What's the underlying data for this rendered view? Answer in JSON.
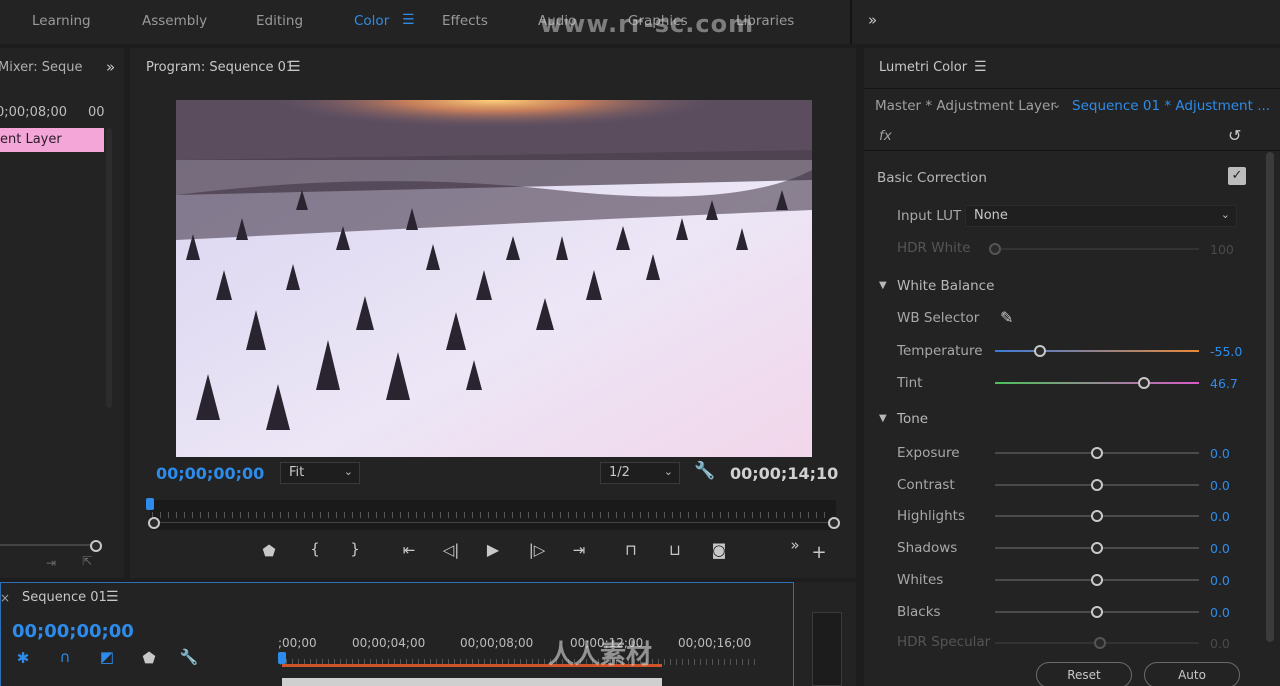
{
  "workspace_tabs": [
    {
      "label": "Learning",
      "active": false
    },
    {
      "label": "Assembly",
      "active": false
    },
    {
      "label": "Editing",
      "active": false
    },
    {
      "label": "Color",
      "active": true
    },
    {
      "label": "Effects",
      "active": false
    },
    {
      "label": "Audio",
      "active": false
    },
    {
      "label": "Graphics",
      "active": false
    },
    {
      "label": "Libraries",
      "active": false
    }
  ],
  "watermark": "www.rr-sc.com",
  "left_panel": {
    "title": "Mixer: Seque",
    "timecode": "0;00;08;00",
    "timecode_end": "00",
    "clip_label": "ent Layer"
  },
  "program": {
    "title": "Program: Sequence 01",
    "current_time": "00;00;00;00",
    "duration": "00;00;14;10",
    "fit_label": "Fit",
    "resolution_label": "1/2"
  },
  "lumetri": {
    "title": "Lumetri Color",
    "master_label": "Master * Adjustment Layer",
    "sequence_label": "Sequence 01 * Adjustment ...",
    "fx_label": "fx",
    "basic_correction": "Basic Correction",
    "input_lut_label": "Input LUT",
    "input_lut_value": "None",
    "hdr_white_label": "HDR White",
    "hdr_white_value": "100",
    "white_balance": "White Balance",
    "wb_selector": "WB Selector",
    "sliders": [
      {
        "label": "Temperature",
        "value": "-55.0",
        "level": 0.22
      },
      {
        "label": "Tint",
        "value": "46.7",
        "level": 0.73
      }
    ],
    "tone": "Tone",
    "tone_sliders": [
      {
        "label": "Exposure",
        "value": "0.0",
        "level": 0.5
      },
      {
        "label": "Contrast",
        "value": "0.0",
        "level": 0.5
      },
      {
        "label": "Highlights",
        "value": "0.0",
        "level": 0.5
      },
      {
        "label": "Shadows",
        "value": "0.0",
        "level": 0.5
      },
      {
        "label": "Whites",
        "value": "0.0",
        "level": 0.5
      },
      {
        "label": "Blacks",
        "value": "0.0",
        "level": 0.5
      }
    ],
    "hdr_specular_label": "HDR Specular",
    "hdr_specular_value": "0.0",
    "reset_label": "Reset",
    "auto_label": "Auto"
  },
  "timeline": {
    "close_label": "×",
    "title": "Sequence 01",
    "current_time": "00;00;00;00",
    "ruler_labels": [
      ";00;00",
      "00;00;04;00",
      "00;00;08;00",
      "00;00;12;00",
      "00;00;16;00"
    ],
    "brand_watermark": "人人素材"
  },
  "colors": {
    "accent": "#2d8ceb",
    "clip_pink": "#f4a6d8",
    "temperature_gradient": [
      "#3c7bd8",
      "#e8883a"
    ],
    "tint_gradient": [
      "#4cc05a",
      "#d85ac8"
    ]
  }
}
